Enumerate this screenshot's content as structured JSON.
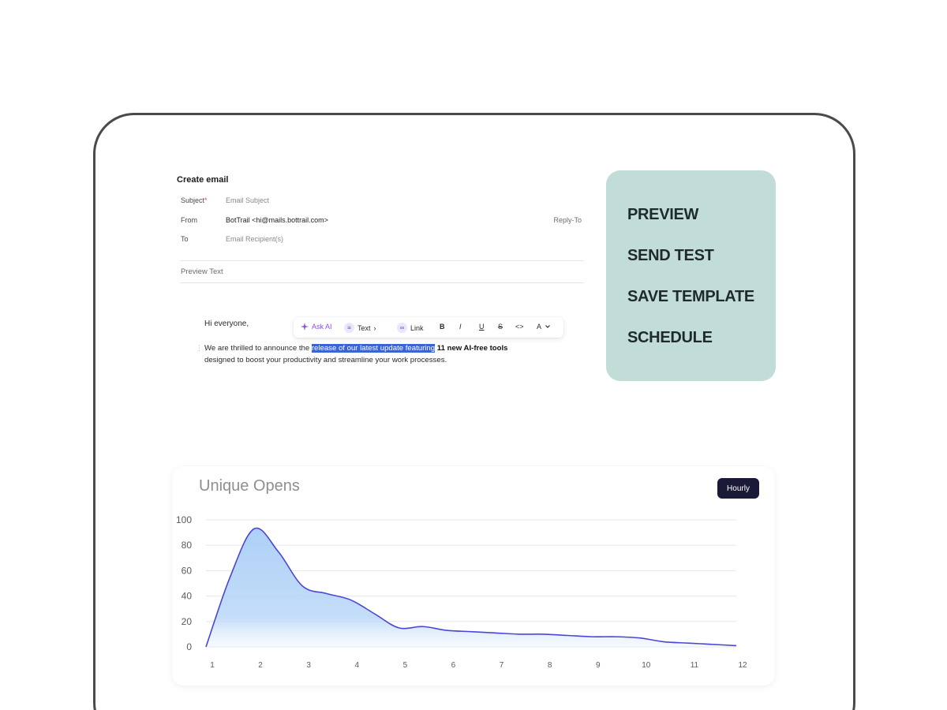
{
  "email": {
    "title": "Create email",
    "subject_label": "Subject",
    "subject_required": "*",
    "subject_placeholder": "Email Subject",
    "from_label": "From",
    "from_value": "BotTrail <hi@mails.bottrail.com>",
    "reply_to": "Reply-To",
    "to_label": "To",
    "to_placeholder": "Email Recipient(s)",
    "preview_text_label": "Preview Text",
    "greeting": "Hi everyone,",
    "body_part1": "We are thrilled to announce the ",
    "body_highlight": "release of our latest update featuring",
    "body_bold": " 11 new AI-free tools",
    "body_part2": "designed to boost your productivity and streamline your work processes."
  },
  "toolbar": {
    "ask_ai": "Ask AI",
    "text": "Text",
    "link": "Link",
    "bold": "B",
    "italic": "I",
    "underline": "U",
    "strike": "S",
    "code": "<>",
    "color": "A"
  },
  "actions": {
    "items": [
      "PREVIEW",
      "SEND TEST",
      "SAVE TEMPLATE",
      "SCHEDULE"
    ],
    "background": "#c2ddd8"
  },
  "chart": {
    "filter_label": "Hourly"
  },
  "chart_data": {
    "type": "area",
    "title": "Unique Opens",
    "x": [
      1,
      1.5,
      2,
      2.5,
      3,
      3.5,
      4,
      4.5,
      5,
      5.5,
      6,
      6.5,
      7,
      7.5,
      8,
      8.5,
      9,
      9.5,
      10,
      10.5,
      11,
      11.5,
      12
    ],
    "series": [
      {
        "values": [
          0,
          55,
          93,
          75,
          48,
          42,
          37,
          26,
          15,
          16,
          13,
          12,
          11,
          10,
          10,
          9,
          8,
          8,
          7,
          4,
          3,
          2,
          1
        ]
      }
    ],
    "x_ticks": [
      1,
      2,
      3,
      4,
      5,
      6,
      7,
      8,
      9,
      10,
      11,
      12
    ],
    "y_ticks": [
      0,
      20,
      40,
      60,
      80,
      100
    ],
    "ylim": [
      0,
      100
    ],
    "xlim": [
      1,
      12
    ],
    "grid": true,
    "line_color": "#4b46d6",
    "fill_color": "#a9cdf7"
  }
}
